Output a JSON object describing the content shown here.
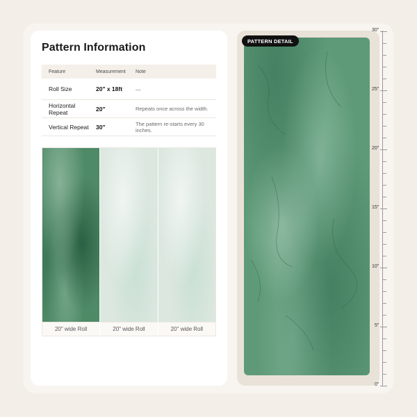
{
  "info": {
    "title": "Pattern Information",
    "columns": [
      "Feature",
      "Measurement",
      "Note"
    ],
    "rows": [
      {
        "feature": "Roll Size",
        "measurement": "20\" x 18ft",
        "note": "—"
      },
      {
        "feature": "Horizontal Repeat",
        "measurement": "20\"",
        "note": "Repeats once across the width."
      },
      {
        "feature": "Vertical Repeat",
        "measurement": "30\"",
        "note": "The pattern re-starts every 30 inches."
      }
    ],
    "roll_captions": [
      "20\" wide Roll",
      "20\" wide Roll",
      "20\" wide Roll"
    ]
  },
  "detail": {
    "badge": "PATTERN DETAIL",
    "ruler_labels": [
      "30\"",
      "25\"",
      "20\"",
      "15\"",
      "10\"",
      "5\"",
      "0\""
    ]
  },
  "colors": {
    "background": "#f3eee8",
    "card": "#ffffff",
    "detail_panel": "#e9e2d8",
    "texture_green": "#5e9a78",
    "badge": "#111111"
  }
}
